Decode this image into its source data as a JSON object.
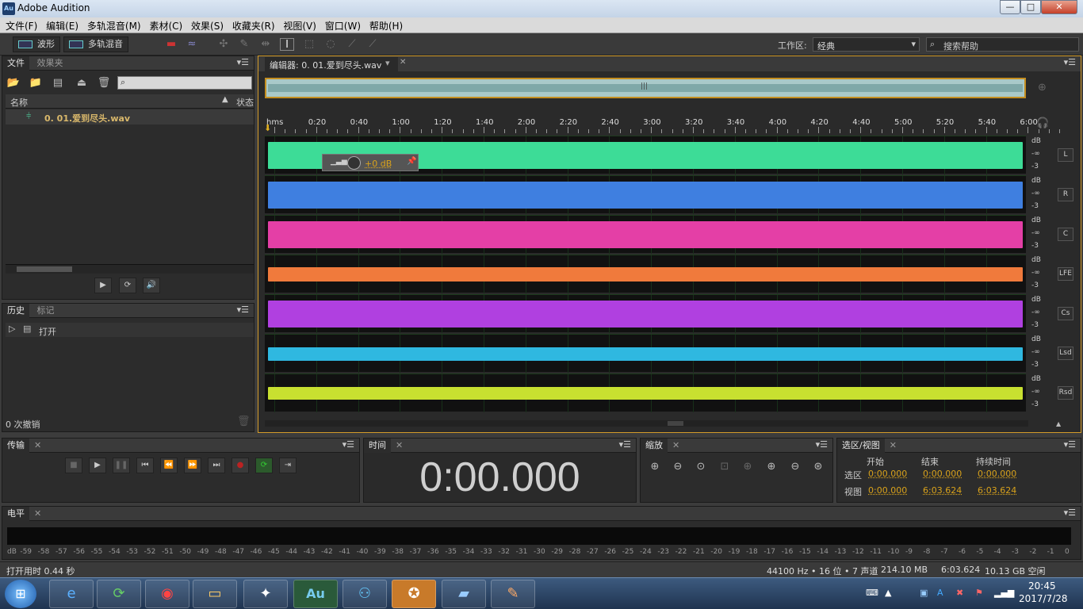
{
  "title_bar": {
    "app_icon_text": "Au",
    "title": "Adobe Audition",
    "minimize": "—",
    "maximize": "□",
    "close": "✕"
  },
  "menu": [
    "文件(F)",
    "编辑(E)",
    "多轨混音(M)",
    "素材(C)",
    "效果(S)",
    "收藏夹(R)",
    "视图(V)",
    "窗口(W)",
    "帮助(H)"
  ],
  "toolbar": {
    "waveform_label": "波形",
    "multitrack_label": "多轨混音",
    "workspace_label": "工作区:",
    "workspace_value": "经典",
    "search_help_placeholder": "搜索帮助"
  },
  "files_panel": {
    "tabs": [
      "文件",
      "效果夹"
    ],
    "col_name": "名称",
    "col_status": "状态",
    "file_name": "0. 01.爱到尽头.wav"
  },
  "history_panel": {
    "tabs": [
      "历史",
      "标记"
    ],
    "item": "打开",
    "undo_count": "0 次撤销"
  },
  "editor": {
    "tab_label": "编辑器: 0. 01.爱到尽头.wav",
    "ruler_labels": [
      "hms",
      "0:20",
      "0:40",
      "1:00",
      "1:20",
      "1:40",
      "2:00",
      "2:20",
      "2:40",
      "3:00",
      "3:20",
      "3:40",
      "4:00",
      "4:20",
      "4:40",
      "5:00",
      "5:20",
      "5:40",
      "6:00"
    ],
    "hud_value": "+0 dB",
    "db_unit": "dB",
    "db_inf": "-∞",
    "db_minus3": "-3",
    "channels": [
      {
        "name": "L",
        "color": "#3ddc97"
      },
      {
        "name": "R",
        "color": "#3f7fe0"
      },
      {
        "name": "C",
        "color": "#e43fa6"
      },
      {
        "name": "LFE",
        "color": "#f07a3c"
      },
      {
        "name": "Cs",
        "color": "#b040e0"
      },
      {
        "name": "Lsd",
        "color": "#2fb8e0"
      },
      {
        "name": "Rsd",
        "color": "#c8e030"
      }
    ]
  },
  "transport_panel": {
    "tab": "传输"
  },
  "time_panel": {
    "tab": "时间",
    "time": "0:00.000"
  },
  "zoom_panel": {
    "tab": "缩放"
  },
  "selection_panel": {
    "tab": "选区/视图",
    "col_start": "开始",
    "col_end": "结束",
    "col_duration": "持续时间",
    "row_selection": "选区",
    "row_view": "视图",
    "sel_start": "0:00.000",
    "sel_end": "0:00.000",
    "sel_duration": "0:00.000",
    "view_start": "0:00.000",
    "view_end": "6:03.624",
    "view_duration": "6:03.624"
  },
  "levels_panel": {
    "tab": "电平",
    "scale": [
      "dB",
      "-59",
      "-58",
      "-57",
      "-56",
      "-55",
      "-54",
      "-53",
      "-52",
      "-51",
      "-50",
      "-49",
      "-48",
      "-47",
      "-46",
      "-45",
      "-44",
      "-43",
      "-42",
      "-41",
      "-40",
      "-39",
      "-38",
      "-37",
      "-36",
      "-35",
      "-34",
      "-33",
      "-32",
      "-31",
      "-30",
      "-29",
      "-28",
      "-27",
      "-26",
      "-25",
      "-24",
      "-23",
      "-22",
      "-21",
      "-20",
      "-19",
      "-18",
      "-17",
      "-16",
      "-15",
      "-14",
      "-13",
      "-12",
      "-11",
      "-10",
      "-9",
      "-8",
      "-7",
      "-6",
      "-5",
      "-4",
      "-3",
      "-2",
      "-1",
      "0"
    ]
  },
  "status_bar": {
    "left": "打开用时 0.44 秒",
    "format": "44100 Hz • 16 位 • 7 声道",
    "size": "214.10 MB",
    "duration": "6:03.624",
    "free": "10.13 GB 空闲"
  },
  "taskbar": {
    "time": "20:45",
    "date": "2017/7/28",
    "au_icon": "Au"
  }
}
